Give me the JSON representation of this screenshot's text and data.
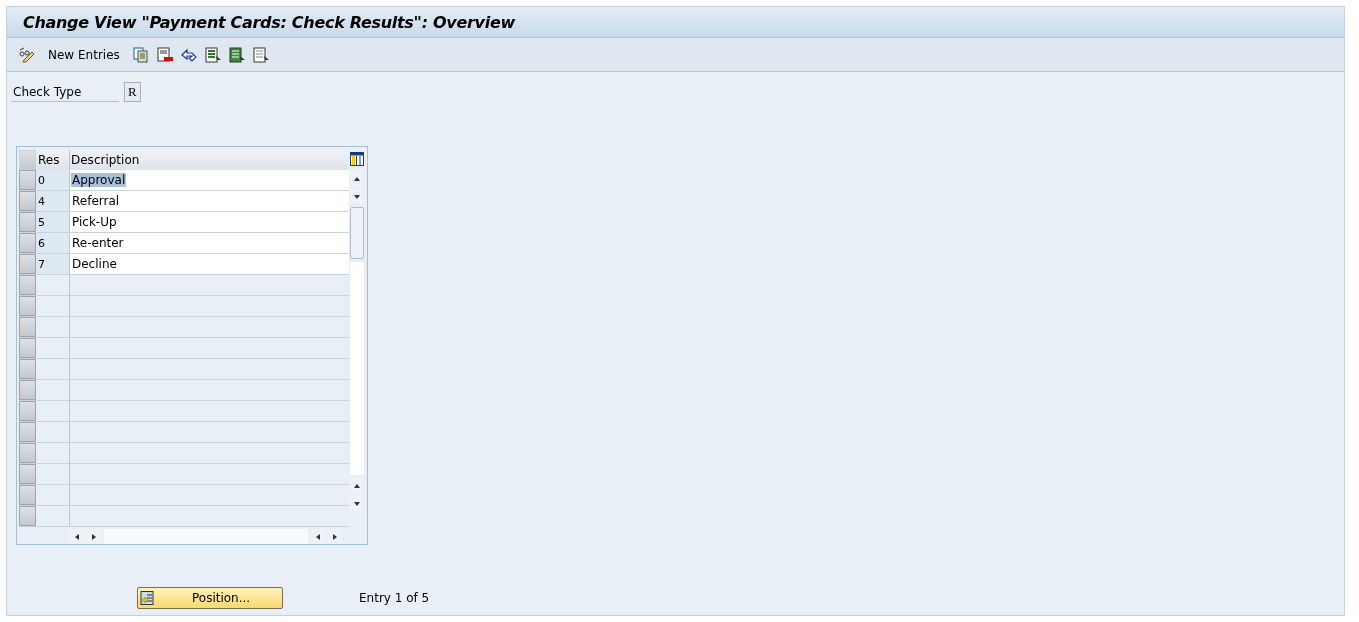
{
  "window": {
    "title": "Change View \"Payment Cards: Check Results\": Overview"
  },
  "toolbar": {
    "items": [
      {
        "kind": "glasses"
      },
      {
        "kind": "text",
        "label": "New Entries"
      },
      {
        "kind": "copy"
      },
      {
        "kind": "delete"
      },
      {
        "kind": "undo"
      },
      {
        "kind": "select-all"
      },
      {
        "kind": "select-block"
      },
      {
        "kind": "deselect"
      }
    ]
  },
  "check_type": {
    "label": "Check Type",
    "value": "R"
  },
  "table": {
    "columns": [
      "Res",
      "Description"
    ],
    "rows": [
      {
        "res": "0",
        "description": "Approval",
        "selected": true
      },
      {
        "res": "4",
        "description": "Referral",
        "selected": false
      },
      {
        "res": "5",
        "description": "Pick-Up",
        "selected": false
      },
      {
        "res": "6",
        "description": "Re-enter",
        "selected": false
      },
      {
        "res": "7",
        "description": "Decline",
        "selected": false
      }
    ]
  },
  "position_button": {
    "label": "Position..."
  },
  "entry_info": "Entry 1 of 5"
}
